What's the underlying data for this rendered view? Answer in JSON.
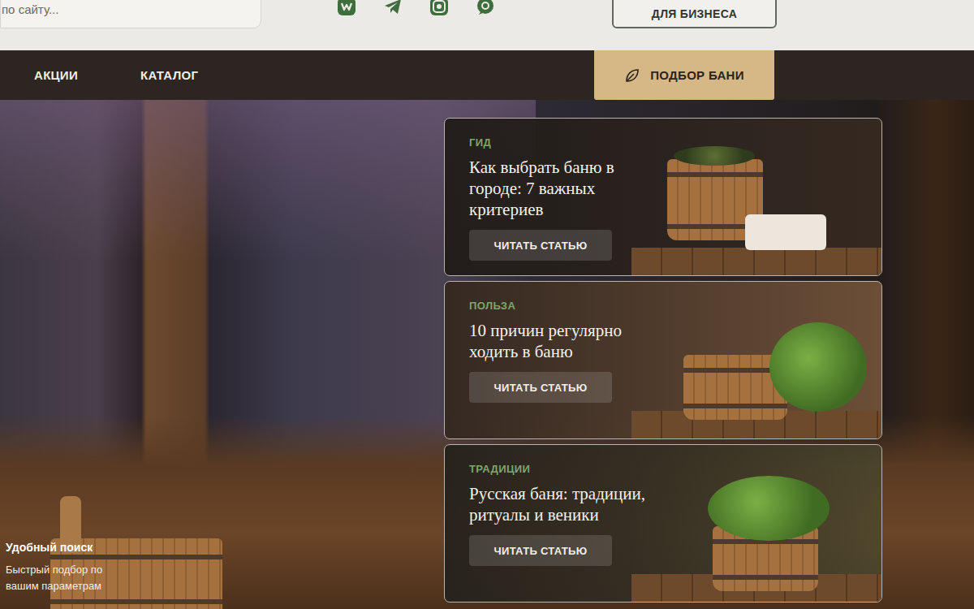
{
  "search": {
    "placeholder": "по сайту..."
  },
  "business_button": "ДЛЯ БИЗНЕСА",
  "nav": {
    "items": [
      {
        "label": "АКЦИИ"
      },
      {
        "label": "КАТАЛОГ"
      }
    ],
    "cta": "ПОДБОР БАНИ"
  },
  "hero": {
    "feature_title": "Удобный поиск",
    "feature_text": "Быстрый подбор по вашим параметрам"
  },
  "articles": [
    {
      "category": "ГИД",
      "title": "Как выбрать баню в городе: 7 важных критериев",
      "button": "ЧИТАТЬ СТАТЬЮ"
    },
    {
      "category": "ПОЛЬЗА",
      "title": "10 причин регулярно ходить в баню",
      "button": "ЧИТАТЬ СТАТЬЮ"
    },
    {
      "category": "ТРАДИЦИИ",
      "title": "Русская баня: традиции, ритуалы и веники",
      "button": "ЧИТАТЬ СТАТЬЮ"
    }
  ]
}
